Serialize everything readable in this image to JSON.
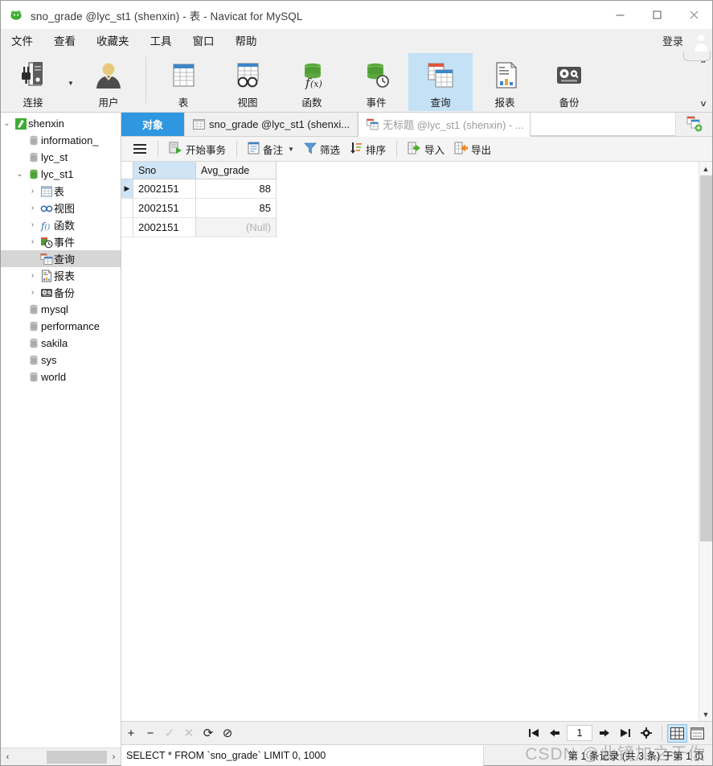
{
  "window": {
    "title": "sno_grade @lyc_st1 (shenxin) - 表 - Navicat for MySQL",
    "app_icon": "navicat-logo-icon",
    "minimize": "—",
    "maximize": "□",
    "close": "✕"
  },
  "menubar": {
    "items": [
      {
        "label": "文件",
        "name": "menu-file"
      },
      {
        "label": "查看",
        "name": "menu-view"
      },
      {
        "label": "收藏夹",
        "name": "menu-favorites"
      },
      {
        "label": "工具",
        "name": "menu-tools"
      },
      {
        "label": "窗口",
        "name": "menu-window"
      },
      {
        "label": "帮助",
        "name": "menu-help"
      }
    ],
    "login_label": "登录",
    "avatar": "user-avatar-icon"
  },
  "ribbon": {
    "buttons": [
      {
        "label": "连接",
        "icon": "connection-icon",
        "active": false
      },
      {
        "label": "用户",
        "icon": "user-icon",
        "active": false
      },
      {
        "label": "表",
        "icon": "table-icon",
        "active": false
      },
      {
        "label": "视图",
        "icon": "view-glasses-icon",
        "active": false
      },
      {
        "label": "函数",
        "icon": "function-icon",
        "active": false
      },
      {
        "label": "事件",
        "icon": "event-clock-icon",
        "active": false
      },
      {
        "label": "查询",
        "icon": "query-icon",
        "active": true
      },
      {
        "label": "报表",
        "icon": "report-icon",
        "active": false
      },
      {
        "label": "备份",
        "icon": "backup-icon",
        "active": false
      }
    ],
    "expand_up": "˄",
    "expand_down": "˅",
    "overflow": "»"
  },
  "sidebar": {
    "tree": [
      {
        "label": "shenxin",
        "indent": 0,
        "expander": "⌄",
        "icon": "connection-green-icon",
        "selected": false
      },
      {
        "label": "information_",
        "indent": 1,
        "expander": "",
        "icon": "database-gray-icon",
        "selected": false
      },
      {
        "label": "lyc_st",
        "indent": 1,
        "expander": "",
        "icon": "database-gray-icon",
        "selected": false
      },
      {
        "label": "lyc_st1",
        "indent": 1,
        "expander": "⌄",
        "icon": "database-green-icon",
        "selected": false
      },
      {
        "label": "表",
        "indent": 2,
        "expander": "›",
        "icon": "table-icon",
        "selected": false
      },
      {
        "label": "视图",
        "indent": 2,
        "expander": "›",
        "icon": "view-glasses-icon",
        "selected": false
      },
      {
        "label": "函数",
        "indent": 2,
        "expander": "›",
        "icon": "function-icon",
        "selected": false
      },
      {
        "label": "事件",
        "indent": 2,
        "expander": "›",
        "icon": "event-clock-icon",
        "selected": false
      },
      {
        "label": "查询",
        "indent": 2,
        "expander": "",
        "icon": "query-icon",
        "selected": true
      },
      {
        "label": "报表",
        "indent": 2,
        "expander": "›",
        "icon": "report-icon",
        "selected": false
      },
      {
        "label": "备份",
        "indent": 2,
        "expander": "›",
        "icon": "backup-icon",
        "selected": false
      },
      {
        "label": "mysql",
        "indent": 1,
        "expander": "",
        "icon": "database-gray-icon",
        "selected": false
      },
      {
        "label": "performance",
        "indent": 1,
        "expander": "",
        "icon": "database-gray-icon",
        "selected": false
      },
      {
        "label": "sakila",
        "indent": 1,
        "expander": "",
        "icon": "database-gray-icon",
        "selected": false
      },
      {
        "label": "sys",
        "indent": 1,
        "expander": "",
        "icon": "database-gray-icon",
        "selected": false
      },
      {
        "label": "world",
        "indent": 1,
        "expander": "",
        "icon": "database-gray-icon",
        "selected": false
      }
    ],
    "scroll_left": "‹",
    "scroll_right": "›"
  },
  "tabs": {
    "object_tab": "对象",
    "items": [
      {
        "label": "sno_grade @lyc_st1 (shenxi...",
        "icon": "table-icon",
        "state": "mid"
      },
      {
        "label": "无标题 @lyc_st1 (shenxin) - ...",
        "icon": "query-icon",
        "state": "cur"
      }
    ],
    "new_tab_icon": "new-query-tab-icon"
  },
  "gridbar": {
    "hamburger": "hamburger-icon",
    "buttons": [
      {
        "label": "开始事务",
        "icon": "begin-transaction-icon",
        "caret": false
      },
      {
        "label": "备注",
        "icon": "note-icon",
        "caret": true
      },
      {
        "label": "筛选",
        "icon": "filter-icon",
        "caret": false
      },
      {
        "label": "排序",
        "icon": "sort-icon",
        "caret": false
      },
      {
        "label": "导入",
        "icon": "import-icon",
        "caret": false
      },
      {
        "label": "导出",
        "icon": "export-icon",
        "caret": false
      }
    ]
  },
  "grid": {
    "columns": [
      {
        "name": "Sno",
        "highlighted": true
      },
      {
        "name": "Avg_grade",
        "highlighted": false
      }
    ],
    "rows": [
      {
        "current": true,
        "Sno": "2002151",
        "Avg_grade": "88",
        "avg_null": false
      },
      {
        "current": false,
        "Sno": "2002151",
        "Avg_grade": "85",
        "avg_null": false
      },
      {
        "current": false,
        "Sno": "2002151",
        "Avg_grade": "(Null)",
        "avg_null": true
      }
    ],
    "current_row_marker": "▶"
  },
  "bottombar": {
    "add": "+",
    "remove": "−",
    "apply": "✓",
    "cancel": "✕",
    "refresh": "⟳",
    "stop": "⊘",
    "first_page": "⮜❘",
    "prev_page": "⬅",
    "page_value": "1",
    "next_page": "➡",
    "last_page": "❘⮞",
    "settings": "gear-icon",
    "grid_view": "grid-view-icon",
    "form_view": "form-view-icon"
  },
  "statusbar": {
    "sql": "SELECT * FROM `sno_grade` LIMIT 0, 1000",
    "record_info": "第 1 条记录 (共 3 条) 于第 1 页",
    "watermark": "CSDN @此镜加之于你"
  },
  "colors": {
    "accent_blue": "#2e97e0",
    "ribbon_active": "#c4e1f6",
    "header_highlight": "#cfe4f5",
    "tree_selected": "#d6d6d6",
    "null_text": "#b1b1b1"
  }
}
